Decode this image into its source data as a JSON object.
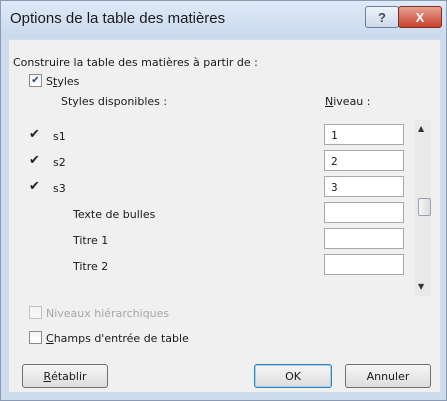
{
  "window": {
    "title": "Options de la table des matières",
    "help_label": "?",
    "close_label": "X"
  },
  "content": {
    "build_from_label": "Construire la table des matières à partir de :",
    "styles": {
      "label_first": "S",
      "label_underlined": "t",
      "label_rest": "yles",
      "checked": true
    },
    "available_styles_label": "Styles disponibles :",
    "level_label_first": "N",
    "level_label_rest": "iveau :",
    "rows": [
      {
        "marked": true,
        "name": "s1",
        "level": "1"
      },
      {
        "marked": true,
        "name": "s2",
        "level": "2"
      },
      {
        "marked": true,
        "name": "s3",
        "level": "3"
      },
      {
        "marked": false,
        "name": "Texte de bulles",
        "level": ""
      },
      {
        "marked": false,
        "name": "Titre 1",
        "level": ""
      },
      {
        "marked": false,
        "name": "Titre 2",
        "level": ""
      }
    ],
    "hierarchy_levels_label": "Niveaux hiérarchiques",
    "table_entry_fields": {
      "label_first": "C",
      "label_rest": "hamps d'entrée de table",
      "checked": false
    }
  },
  "buttons": {
    "reset_first": "R",
    "reset_rest": "établir",
    "ok": "OK",
    "cancel": "Annuler"
  }
}
